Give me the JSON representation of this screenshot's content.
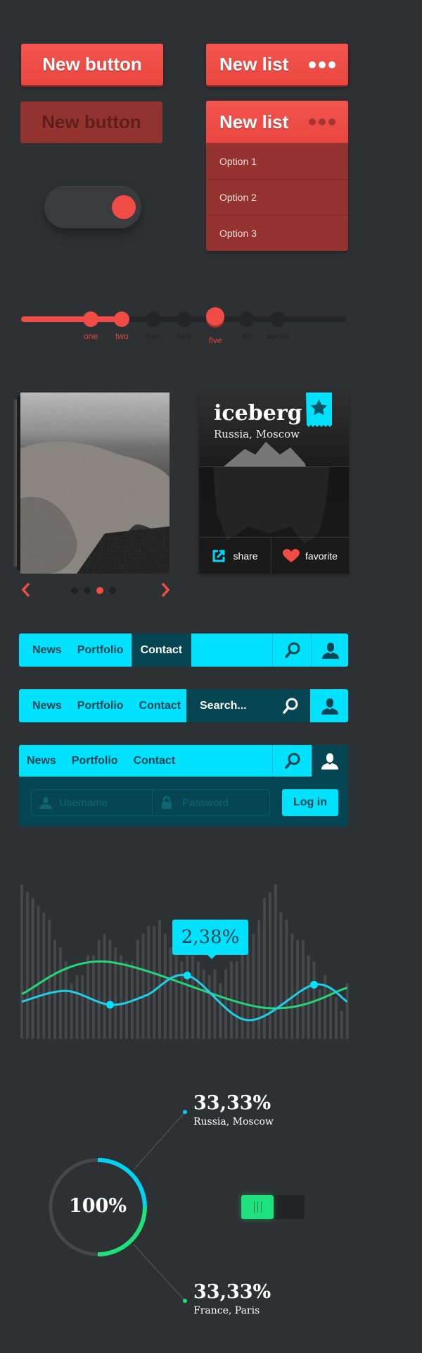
{
  "buttons": {
    "primary_label": "New button",
    "disabled_label": "New button"
  },
  "lists": {
    "collapsed": {
      "label": "New list",
      "icon": "more-dots-icon"
    },
    "expanded": {
      "label": "New list",
      "icon": "more-dots-icon",
      "options": [
        "Option 1",
        "Option 2",
        "Option 3"
      ]
    }
  },
  "toggle": {
    "state": "on"
  },
  "stepper": {
    "steps": [
      {
        "label": "one",
        "state": "filled"
      },
      {
        "label": "two",
        "state": "filled"
      },
      {
        "label": "free",
        "state": "empty"
      },
      {
        "label": "four",
        "state": "empty"
      },
      {
        "label": "five",
        "state": "selected"
      },
      {
        "label": "six",
        "state": "empty"
      },
      {
        "label": "seven",
        "state": "empty"
      }
    ]
  },
  "gallery": {
    "prev_icon": "chevron-left-icon",
    "next_icon": "chevron-right-icon",
    "page_count": 4,
    "active_page": 3
  },
  "card": {
    "title": "iceberg",
    "subtitle": "Russia, Moscow",
    "bookmark_icon": "star-icon",
    "share_label": "share",
    "favorite_label": "favorite"
  },
  "navbars": [
    {
      "items": [
        "News",
        "Portfolio",
        "Contact"
      ],
      "active": "Contact"
    },
    {
      "items": [
        "News",
        "Portfolio",
        "Contact"
      ],
      "search_placeholder": "Search..."
    },
    {
      "items": [
        "News",
        "Portfolio",
        "Contact"
      ],
      "username_placeholder": "Username",
      "password_placeholder": "Password",
      "login_label": "Log in"
    }
  ],
  "colors": {
    "background": "#2e3134",
    "red": "#f04b45",
    "cyan": "#00e1fd",
    "teal_dark": "#064652",
    "green": "#1de27c"
  },
  "chart_data": [
    {
      "type": "bar",
      "bars": [
        100,
        95,
        91,
        86,
        82,
        77,
        64,
        59,
        50,
        36,
        41,
        41,
        54,
        54,
        64,
        68,
        64,
        59,
        54,
        50,
        50,
        64,
        68,
        73,
        73,
        77,
        68,
        59,
        54,
        50,
        54,
        54,
        50,
        45,
        41,
        45,
        36,
        45,
        50,
        50,
        59,
        59,
        68,
        77,
        91,
        95,
        100,
        82,
        77,
        68,
        64,
        64,
        54,
        50,
        32,
        41,
        32,
        27,
        18,
        36
      ],
      "lines": [
        {
          "color": "#1ecfe6",
          "points": [
            [
              0,
              24
            ],
            [
              8,
              31
            ],
            [
              16,
              22
            ],
            [
              22.5,
              28
            ],
            [
              30,
              41
            ],
            [
              41,
              12
            ],
            [
              53,
              35
            ],
            [
              59,
              24
            ]
          ],
          "markers": [
            16,
            30,
            53
          ]
        },
        {
          "color": "#22d67a",
          "points": [
            [
              0,
              29
            ],
            [
              15,
              50
            ],
            [
              44,
              20
            ],
            [
              59,
              33
            ]
          ]
        }
      ],
      "tooltip": "2,38%",
      "grid": false
    },
    {
      "type": "pie",
      "center_label": "100%",
      "segments": [
        {
          "fraction": 0.25,
          "color": "#00d2f2",
          "value_label": "33,33%",
          "label": "Russia, Moscow"
        },
        {
          "fraction": 0.25,
          "color": "#1de27c",
          "value_label": "33,33%",
          "label": "France, Paris"
        }
      ]
    }
  ],
  "switch": {
    "state": "on"
  }
}
